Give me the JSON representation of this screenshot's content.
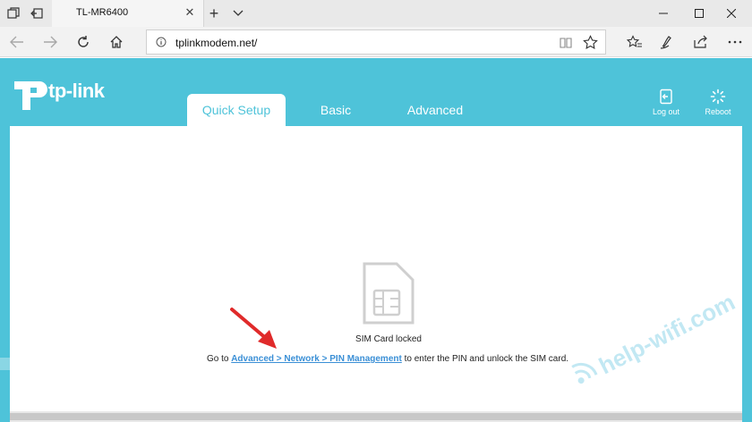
{
  "browser": {
    "tab_title": "TL-MR6400",
    "url": "tplinkmodem.net/",
    "icons": {
      "tab_actions": "tab-actions-icon",
      "set_aside": "set-aside-tabs-icon",
      "close_tab": "close-icon",
      "new_tab": "plus-icon",
      "tab_menu": "chevron-down-icon",
      "minimize": "minimize-icon",
      "maximize": "maximize-icon",
      "close_window": "close-icon",
      "back": "back-arrow-icon",
      "forward": "forward-arrow-icon",
      "refresh": "refresh-icon",
      "home": "home-icon",
      "info": "info-icon",
      "reading_view": "reading-view-icon",
      "favorite": "star-icon",
      "favorites_list": "favorites-icon",
      "notes": "pen-icon",
      "share": "share-icon",
      "more": "more-icon"
    }
  },
  "router": {
    "brand": "tp-link",
    "tabs": [
      {
        "label": "Quick Setup",
        "active": true
      },
      {
        "label": "Basic",
        "active": false
      },
      {
        "label": "Advanced",
        "active": false
      }
    ],
    "logout_label": "Log out",
    "reboot_label": "Reboot",
    "accent_color": "#4ec3d9",
    "link_color": "#3a8fd6"
  },
  "sim_status": {
    "title": "SIM Card locked",
    "prefix": "Go to",
    "link_text": "Advanced > Network > PIN Management",
    "suffix": "to enter the PIN and unlock the SIM card."
  },
  "watermark": {
    "text": "help-wifi.com"
  }
}
